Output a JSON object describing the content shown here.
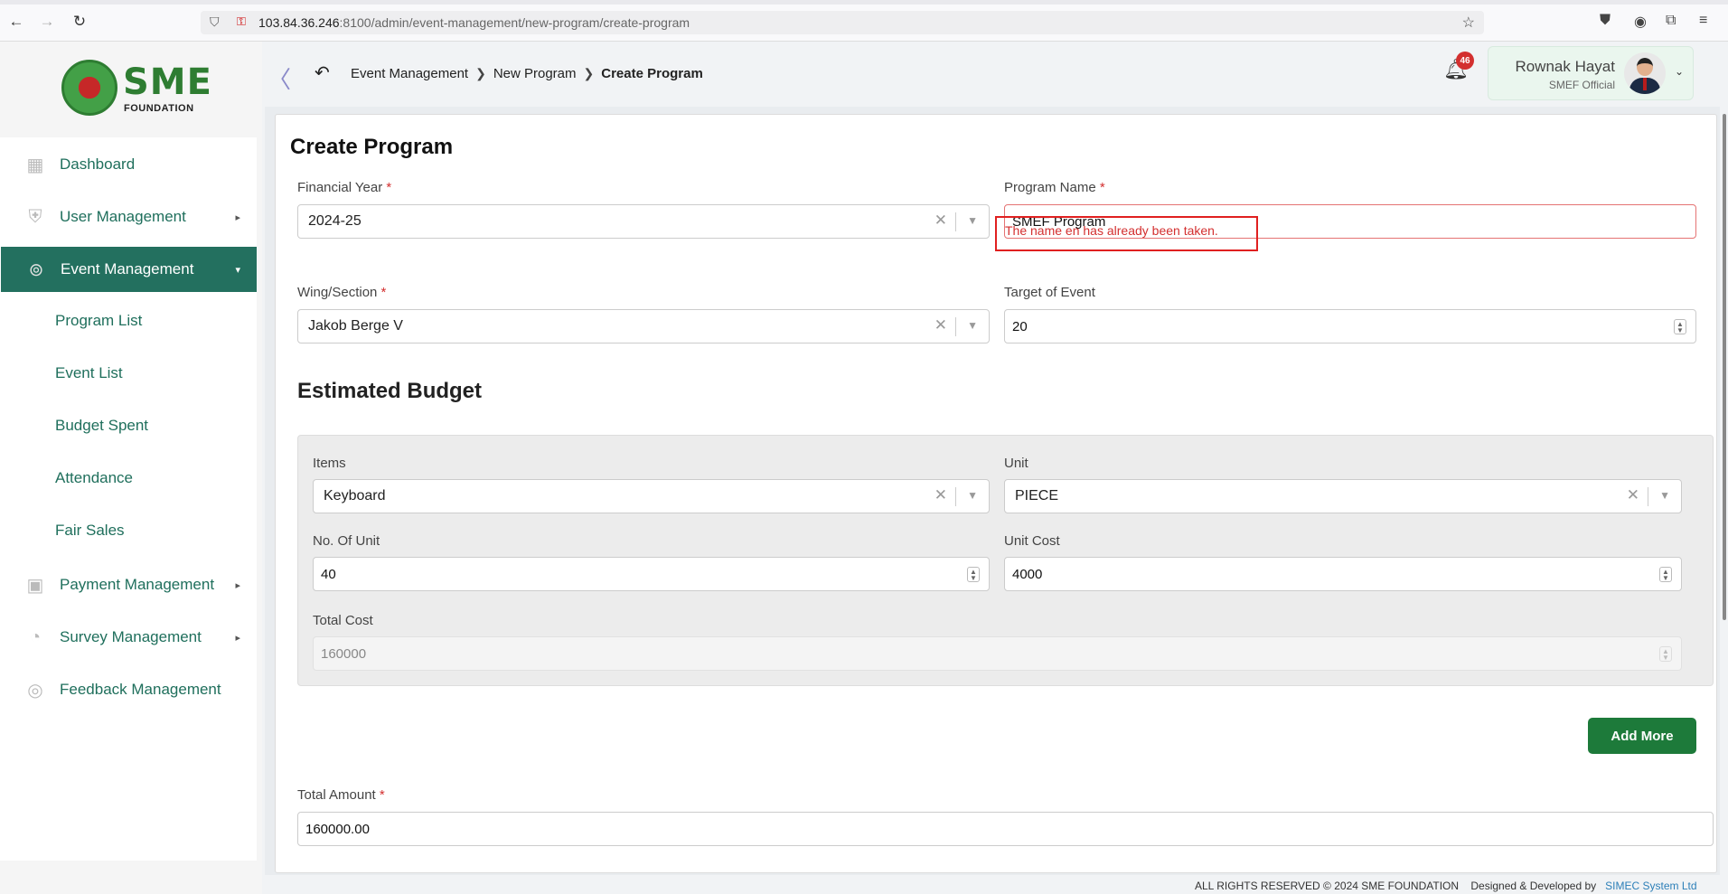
{
  "browser": {
    "url_host": "103.84.36.246",
    "url_rest": ":8100/admin/event-management/new-program/create-program"
  },
  "logo": {
    "brand": "SME",
    "subtitle": "FOUNDATION"
  },
  "sidebar": {
    "items": [
      {
        "label": "Dashboard",
        "icon": "grid-icon"
      },
      {
        "label": "User Management",
        "icon": "user-shield-icon"
      },
      {
        "label": "Event Management",
        "icon": "lock-circle-icon",
        "active": true
      },
      {
        "label": "Payment Management",
        "icon": "money-icon"
      },
      {
        "label": "Survey Management",
        "icon": "pie-icon"
      },
      {
        "label": "Feedback Management",
        "icon": "feedback-icon"
      }
    ],
    "submenu": [
      "Program List",
      "Event List",
      "Budget Spent",
      "Attendance",
      "Fair Sales"
    ]
  },
  "header": {
    "breadcrumb": [
      "Event Management",
      "New Program",
      "Create Program"
    ],
    "notification_count": "46",
    "user_name": "Rownak Hayat",
    "user_role": "SMEF Official"
  },
  "form": {
    "title": "Create Program",
    "financial_year": {
      "label": "Financial Year",
      "value": "2024-25"
    },
    "program_name": {
      "label": "Program Name",
      "value": "SMEF Program",
      "error": "The name en has already been taken."
    },
    "wing_section": {
      "label": "Wing/Section",
      "value": "Jakob Berge V"
    },
    "target_of_event": {
      "label": "Target of Event",
      "value": "20"
    },
    "budget_title": "Estimated Budget",
    "budget": {
      "items": {
        "label": "Items",
        "value": "Keyboard"
      },
      "unit": {
        "label": "Unit",
        "value": "PIECE"
      },
      "no_of_unit": {
        "label": "No. Of Unit",
        "value": "40"
      },
      "unit_cost": {
        "label": "Unit Cost",
        "value": "4000"
      },
      "total_cost": {
        "label": "Total Cost",
        "value": "160000"
      }
    },
    "add_more_label": "Add More",
    "total_amount": {
      "label": "Total Amount",
      "value": "160000.00"
    }
  },
  "footer": {
    "rights": "ALL RIGHTS RESERVED © 2024 SME FOUNDATION",
    "designed": "Designed & Developed by",
    "company": "SIMEC System Ltd"
  },
  "colors": {
    "brand_green": "#23705f",
    "button_green": "#1d7a3a",
    "error_red": "#d32f2f"
  }
}
